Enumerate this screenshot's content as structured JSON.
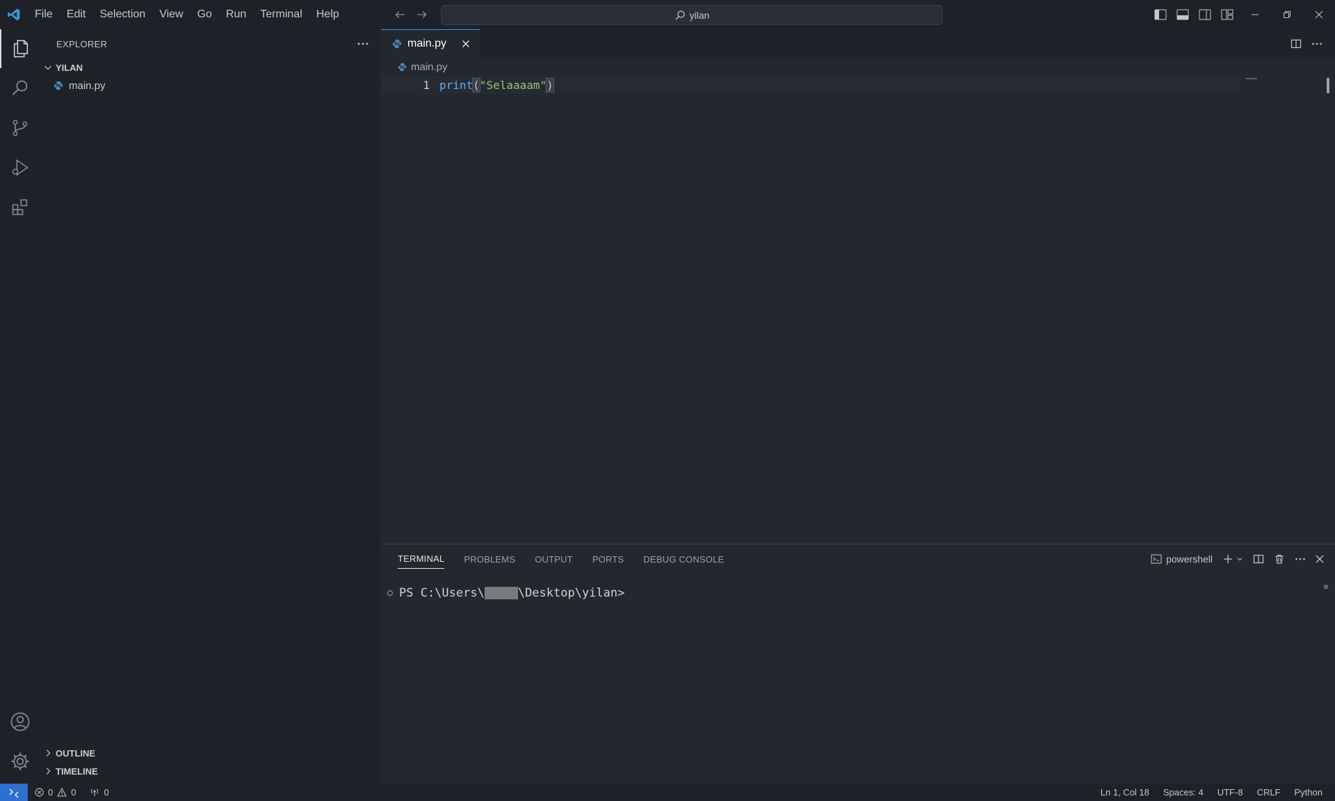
{
  "menu": [
    "File",
    "Edit",
    "Selection",
    "View",
    "Go",
    "Run",
    "Terminal",
    "Help"
  ],
  "command_center": {
    "label": "yilan"
  },
  "sidebar": {
    "title": "EXPLORER",
    "folder": "YILAN",
    "files": [
      "main.py"
    ],
    "outline": "OUTLINE",
    "timeline": "TIMELINE"
  },
  "editor": {
    "tab": "main.py",
    "breadcrumb": "main.py",
    "line_number": "1",
    "code": {
      "fn": "print",
      "open": "(",
      "str": "\"Selaaaam\"",
      "close": ")"
    }
  },
  "panel": {
    "tabs": [
      "TERMINAL",
      "PROBLEMS",
      "OUTPUT",
      "PORTS",
      "DEBUG CONSOLE"
    ],
    "active_tab": "TERMINAL",
    "shell": "powershell",
    "prompt_prefix": "PS C:\\Users\\",
    "prompt_suffix": "\\Desktop\\yilan>"
  },
  "status": {
    "errors": "0",
    "warnings": "0",
    "ports": "0",
    "position": "Ln 1, Col 18",
    "spaces": "Spaces: 4",
    "encoding": "UTF-8",
    "eol": "CRLF",
    "language": "Python"
  },
  "colors": {
    "accent": "#3794ff",
    "remote": "#2f6fcf",
    "python_icon": "#4b8bbe"
  }
}
